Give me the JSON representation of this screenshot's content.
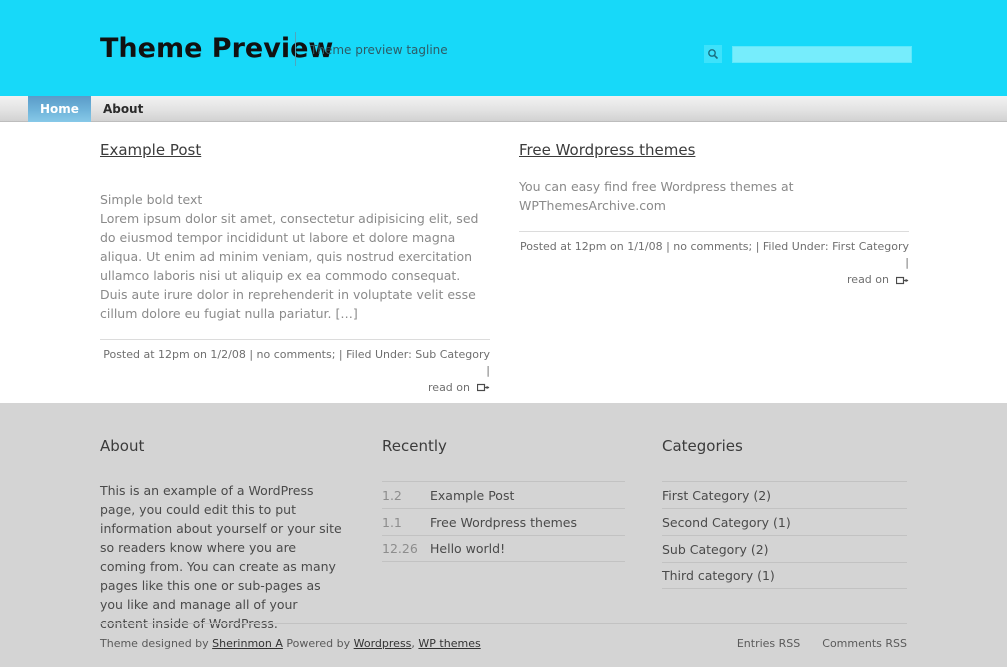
{
  "header": {
    "title": "Theme Preview",
    "tagline": "Theme preview tagline",
    "search": {
      "icon": "search-icon",
      "value": "",
      "placeholder": ""
    },
    "background_color": "#17d9f9"
  },
  "nav": {
    "items": [
      {
        "label": "Home",
        "active": true
      },
      {
        "label": "About",
        "active": false
      }
    ],
    "active_color": "#6fb4da"
  },
  "posts": [
    {
      "title": "Example Post",
      "lead": "Simple bold text",
      "body": "Lorem ipsum dolor sit amet, consectetur adipisicing elit, sed do eiusmod tempor incididunt ut labore et dolore magna aliqua. Ut enim ad minim veniam, quis nostrud exercitation ullamco laboris nisi ut aliquip ex ea commodo consequat. Duis aute irure dolor in reprehenderit in voluptate velit esse cillum dolore eu fugiat nulla pariatur. […]",
      "meta": "Posted at 12pm on 1/2/08 | no comments; | Filed Under: Sub Category |",
      "read_on": "read on",
      "read_on_icon": "read-on-arrow-icon"
    },
    {
      "title": "Free Wordpress themes",
      "lead": "",
      "body": "You can easy find free Wordpress themes at WPThemesArchive.com",
      "meta": "Posted at 12pm on 1/1/08 | no comments; | Filed Under: First Category |",
      "read_on": "read on",
      "read_on_icon": "read-on-arrow-icon"
    }
  ],
  "footer": {
    "about": {
      "title": "About",
      "text": "This is an example of a WordPress page, you could edit this to put information about yourself or your site so readers know where you are coming from. You can create as many pages like this one or sub-pages as you like and manage all of your content inside of WordPress."
    },
    "recently": {
      "title": "Recently",
      "items": [
        {
          "date": "1.2",
          "label": "Example Post"
        },
        {
          "date": "1.1",
          "label": "Free Wordpress themes"
        },
        {
          "date": "12.26",
          "label": "Hello world!"
        }
      ]
    },
    "categories": {
      "title": "Categories",
      "items": [
        {
          "label": "First Category (2)"
        },
        {
          "label": "Second Category (1)"
        },
        {
          "label": "Sub Category (2)"
        },
        {
          "label": "Third category (1)"
        }
      ]
    },
    "credits": {
      "prefix": "Theme designed by ",
      "designer": "Sherinmon A",
      "middle": " Powered by ",
      "platform": "Wordpress",
      "separator": ", ",
      "themes": "WP themes"
    },
    "rss": [
      {
        "label": "Entries RSS"
      },
      {
        "label": "Comments RSS"
      }
    ],
    "background_color": "#d4d4d4"
  }
}
